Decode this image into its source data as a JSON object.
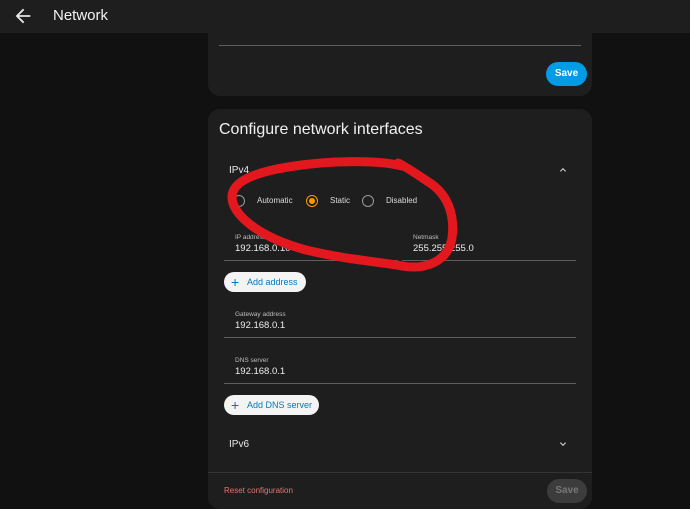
{
  "header": {
    "title": "Network",
    "back_icon": "arrow-left-icon"
  },
  "top_card": {
    "save_label": "Save"
  },
  "interfaces": {
    "heading": "Configure network interfaces",
    "ipv4": {
      "label": "IPv4",
      "modes": [
        {
          "label": "Automatic",
          "selected": false
        },
        {
          "label": "Static",
          "selected": true
        },
        {
          "label": "Disabled",
          "selected": false
        }
      ],
      "ip_address_label": "IP address",
      "ip_address_value": "192.168.0.104",
      "netmask_label": "Netmask",
      "netmask_value": "255.255.255.0",
      "add_address_label": "Add address",
      "gateway_label": "Gateway address",
      "gateway_value": "192.168.0.1",
      "dns_label": "DNS server",
      "dns_value": "192.168.0.1",
      "add_dns_label": "Add DNS server"
    },
    "ipv6": {
      "label": "IPv6"
    },
    "reset_label": "Reset configuration",
    "save_label": "Save"
  },
  "colors": {
    "accent": "#039be5",
    "radio_selected": "#ff9800",
    "annotation": "#e3181e",
    "reset": "#e57373"
  }
}
